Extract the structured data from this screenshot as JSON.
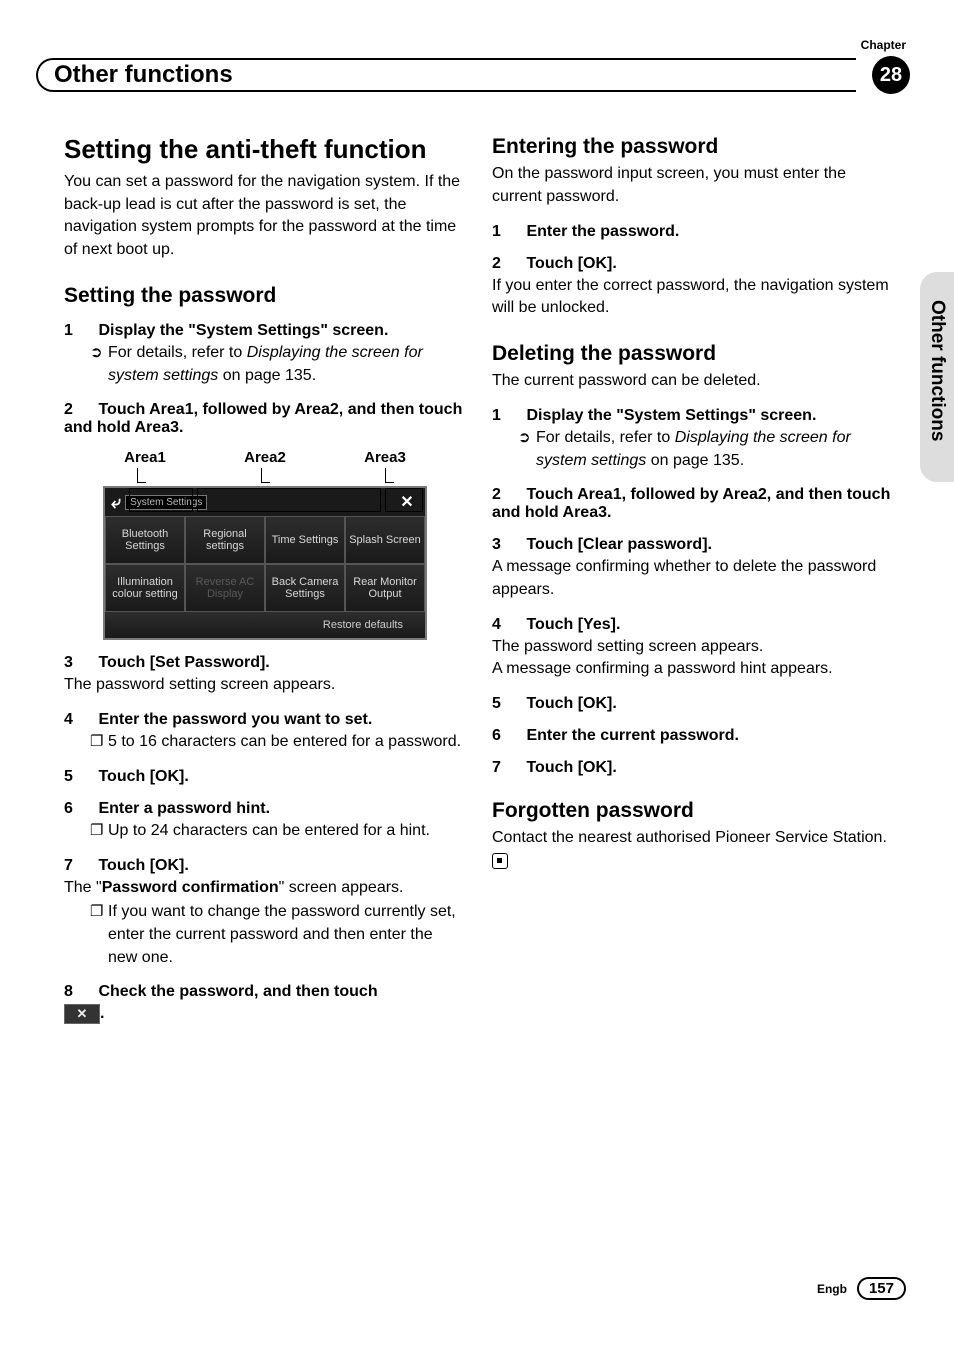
{
  "header": {
    "chapter_label": "Chapter",
    "chapter_number": "28",
    "title": "Other functions",
    "side_tab": "Other functions"
  },
  "left": {
    "h1": "Setting the anti-theft function",
    "intro": "You can set a password for the navigation system. If the back-up lead is cut after the password is set, the navigation system prompts for the password at the time of next boot up.",
    "h2a": "Setting the password",
    "s1_num": "1",
    "s1_txt": "Display the \"System Settings\" screen.",
    "s1_note_a": "For details, refer to ",
    "s1_note_i": "Displaying the screen for system settings",
    "s1_note_b": " on page 135.",
    "s2_num": "2",
    "s2_txt": "Touch Area1, followed by Area2, and then touch and hold Area3.",
    "areas": {
      "a1": "Area1",
      "a2": "Area2",
      "a3": "Area3"
    },
    "shot": {
      "title": "System Settings",
      "cells": [
        "Bluetooth Settings",
        "Regional settings",
        "Time Settings",
        "Splash Screen",
        "Illumination colour setting",
        "Reverse AC Display",
        "Back Camera Settings",
        "Rear Monitor Output"
      ],
      "footer": "Restore defaults"
    },
    "s3_num": "3",
    "s3_txt": "Touch [Set Password].",
    "s3_follow": "The password setting screen appears.",
    "s4_num": "4",
    "s4_txt": "Enter the password you want to set.",
    "s4_note": "5 to 16 characters can be entered for a password.",
    "s5_num": "5",
    "s5_txt": "Touch [OK].",
    "s6_num": "6",
    "s6_txt": "Enter a password hint.",
    "s6_note": "Up to 24 characters can be entered for a hint.",
    "s7_num": "7",
    "s7_txt": "Touch [OK].",
    "s7_follow_a": "The \"",
    "s7_follow_b": "Password confirmation",
    "s7_follow_c": "\" screen appears.",
    "s7_note": "If you want to change the password currently set, enter the current password and then enter the new one.",
    "s8_num": "8",
    "s8_txt_a": "Check the password, and then touch ",
    "s8_txt_b": "."
  },
  "right": {
    "h2a": "Entering the password",
    "p1": "On the password input screen, you must enter the current password.",
    "s1_num": "1",
    "s1_txt": "Enter the password.",
    "s2_num": "2",
    "s2_txt": "Touch [OK].",
    "s2_follow": "If you enter the correct password, the navigation system will be unlocked.",
    "h2b": "Deleting the password",
    "p2": "The current password can be deleted.",
    "d1_num": "1",
    "d1_txt": "Display the \"System Settings\" screen.",
    "d1_note_a": "For details, refer to ",
    "d1_note_i": "Displaying the screen for system settings",
    "d1_note_b": " on page 135.",
    "d2_num": "2",
    "d2_txt": "Touch Area1, followed by Area2, and then touch and hold Area3.",
    "d3_num": "3",
    "d3_txt": "Touch [Clear password].",
    "d3_follow": "A message confirming whether to delete the password appears.",
    "d4_num": "4",
    "d4_txt": "Touch [Yes].",
    "d4_follow": "The password setting screen appears.\nA message confirming a password hint appears.",
    "d5_num": "5",
    "d5_txt": "Touch [OK].",
    "d6_num": "6",
    "d6_txt": "Enter the current password.",
    "d7_num": "7",
    "d7_txt": "Touch [OK].",
    "h2c": "Forgotten password",
    "p3": "Contact the nearest authorised Pioneer Service Station."
  },
  "footer": {
    "lang": "Engb",
    "page": "157"
  }
}
